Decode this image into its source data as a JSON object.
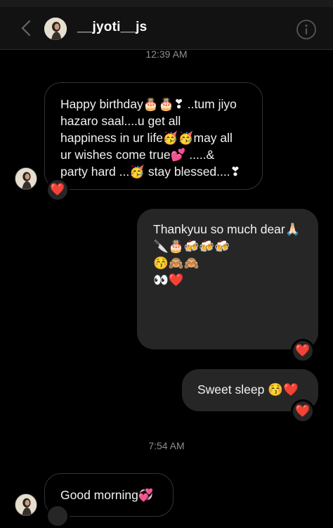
{
  "header": {
    "username": "__jyoti__js"
  },
  "timestamps": [
    "12:39 AM",
    "7:54 AM"
  ],
  "messages": {
    "m1": {
      "lines": [
        "Happy birthday🎂🎂❣ ..tum jiyo",
        "hazaro saal....u get all",
        "happiness in ur life🥳🥳may all",
        "ur wishes come true💕 .....&",
        "party hard ...🥳 stay blessed....❣"
      ],
      "reaction": "❤️"
    },
    "m2": {
      "lines": [
        "Thankyuu so much dear🙏🏻",
        "",
        "",
        "",
        "🔪🎂🍻🍻🍻",
        "😚🙈🙈",
        "👀❤️"
      ],
      "reaction": "❤️"
    },
    "m3": {
      "text": "Sweet sleep 😚❤️",
      "reaction": "❤️"
    },
    "m4": {
      "text": "Good morning💞"
    }
  },
  "colors": {
    "background": "#000000",
    "sent_bubble": "#262626",
    "received_border": "#333333",
    "reaction_heart": "#e0245e"
  }
}
